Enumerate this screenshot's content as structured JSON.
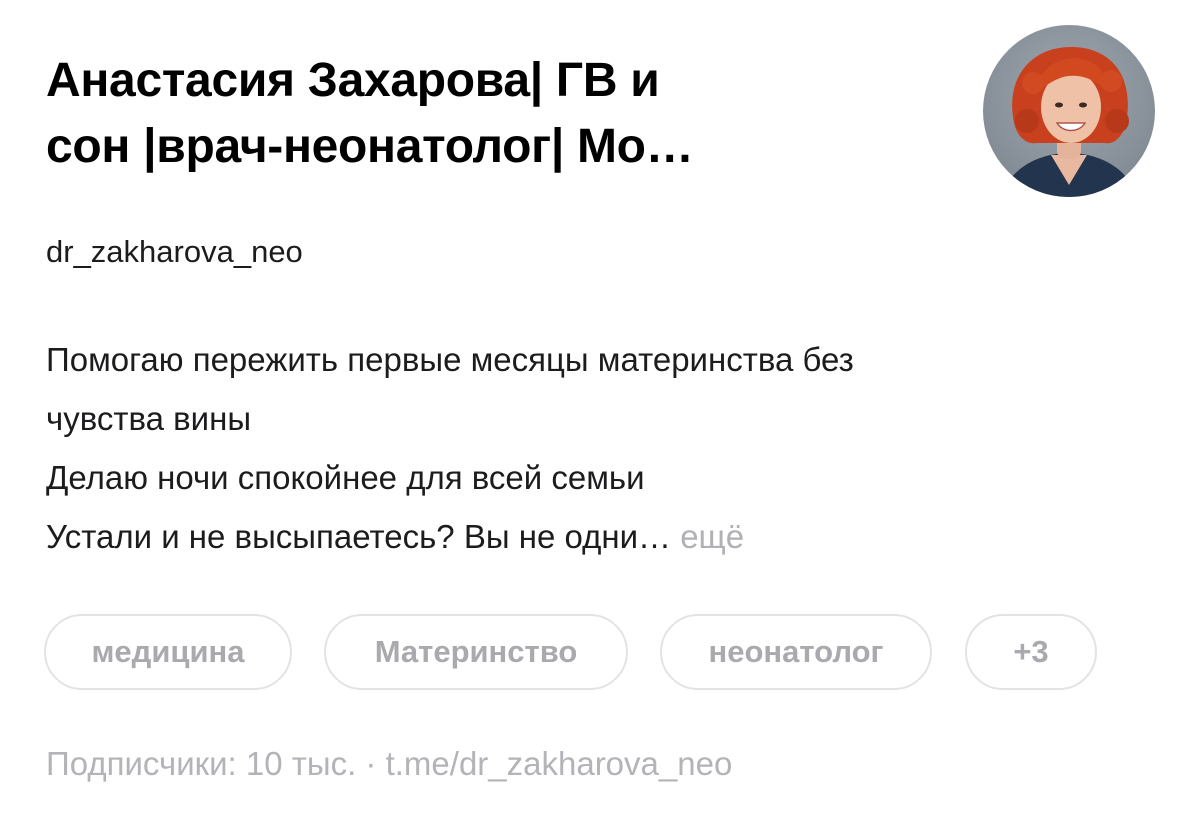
{
  "channel": {
    "title_line1": "Анастасия Захарова| ГВ и",
    "title_line2": "сон |врач-неонатолог| Мо…",
    "username": "dr_zakharova_neo",
    "avatar_icon": "profile-photo"
  },
  "description": {
    "line1": "Помогаю пережить первые месяцы материнства без",
    "line2": "чувства вины",
    "line3": "Делаю ночи спокойнее для всей семьи",
    "line4": "Устали и не высыпаетесь? Вы не одни…",
    "more_label": "ещё"
  },
  "tags": [
    {
      "label": "медицина"
    },
    {
      "label": "Материнство"
    },
    {
      "label": "неонатолог"
    },
    {
      "label": "+3"
    }
  ],
  "footer": {
    "subscribers": "Подписчики: 10 тыс.",
    "separator": "·",
    "link": "t.me/dr_zakharova_neo"
  },
  "colors": {
    "title": "#000000",
    "muted": "#b3b3b8",
    "tag_border": "#e3e3e6",
    "tag_text": "#a9a9ae",
    "avatar_hair": "#c8401e"
  }
}
